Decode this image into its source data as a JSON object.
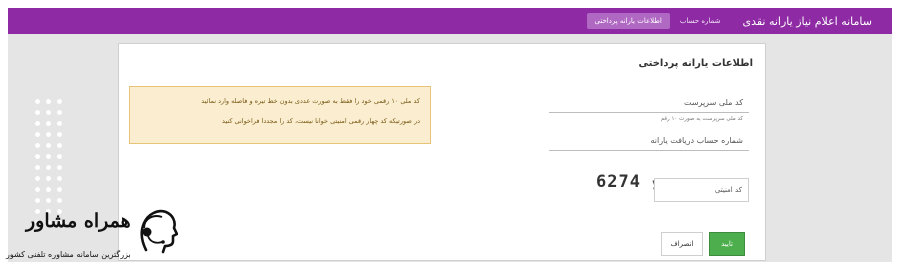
{
  "header": {
    "site_title": "سامانه اعلام نیاز یارانه نقدی",
    "nav": [
      {
        "label": "اطلاعات یارانه پرداختی",
        "active": true
      },
      {
        "label": "شماره حساب",
        "active": false
      }
    ]
  },
  "card": {
    "title": "اطلاعات یارانه پرداختی"
  },
  "form": {
    "national_id_label": "کد ملی سرپرست",
    "national_id_hint": "کد ملی سرپرست به صورت ۱۰ رقم",
    "account_label": "شماره حساب دریافت یارانه",
    "captcha_label": "کد امنیتی",
    "captcha_code": "6274"
  },
  "warning": {
    "line1": "کد ملی ۱۰ رقمی خود را فقط به صورت عددی بدون خط تیره و فاصله وارد نمائید",
    "line2": "در صورتیکه کد چهار رقمی امنیتی خوانا نیست، کد را مجددا فراخوانی کنید"
  },
  "buttons": {
    "confirm": "تایید",
    "cancel": "انصراف"
  },
  "logo": {
    "name": "همراه مشاور",
    "tagline": "بزرگترین سامانه مشاوره تلفنی کشور"
  },
  "colors": {
    "header": "#8e2aa3",
    "active_nav": "#b069c2",
    "confirm": "#4cae4c",
    "warning_bg": "#fbeed0"
  }
}
